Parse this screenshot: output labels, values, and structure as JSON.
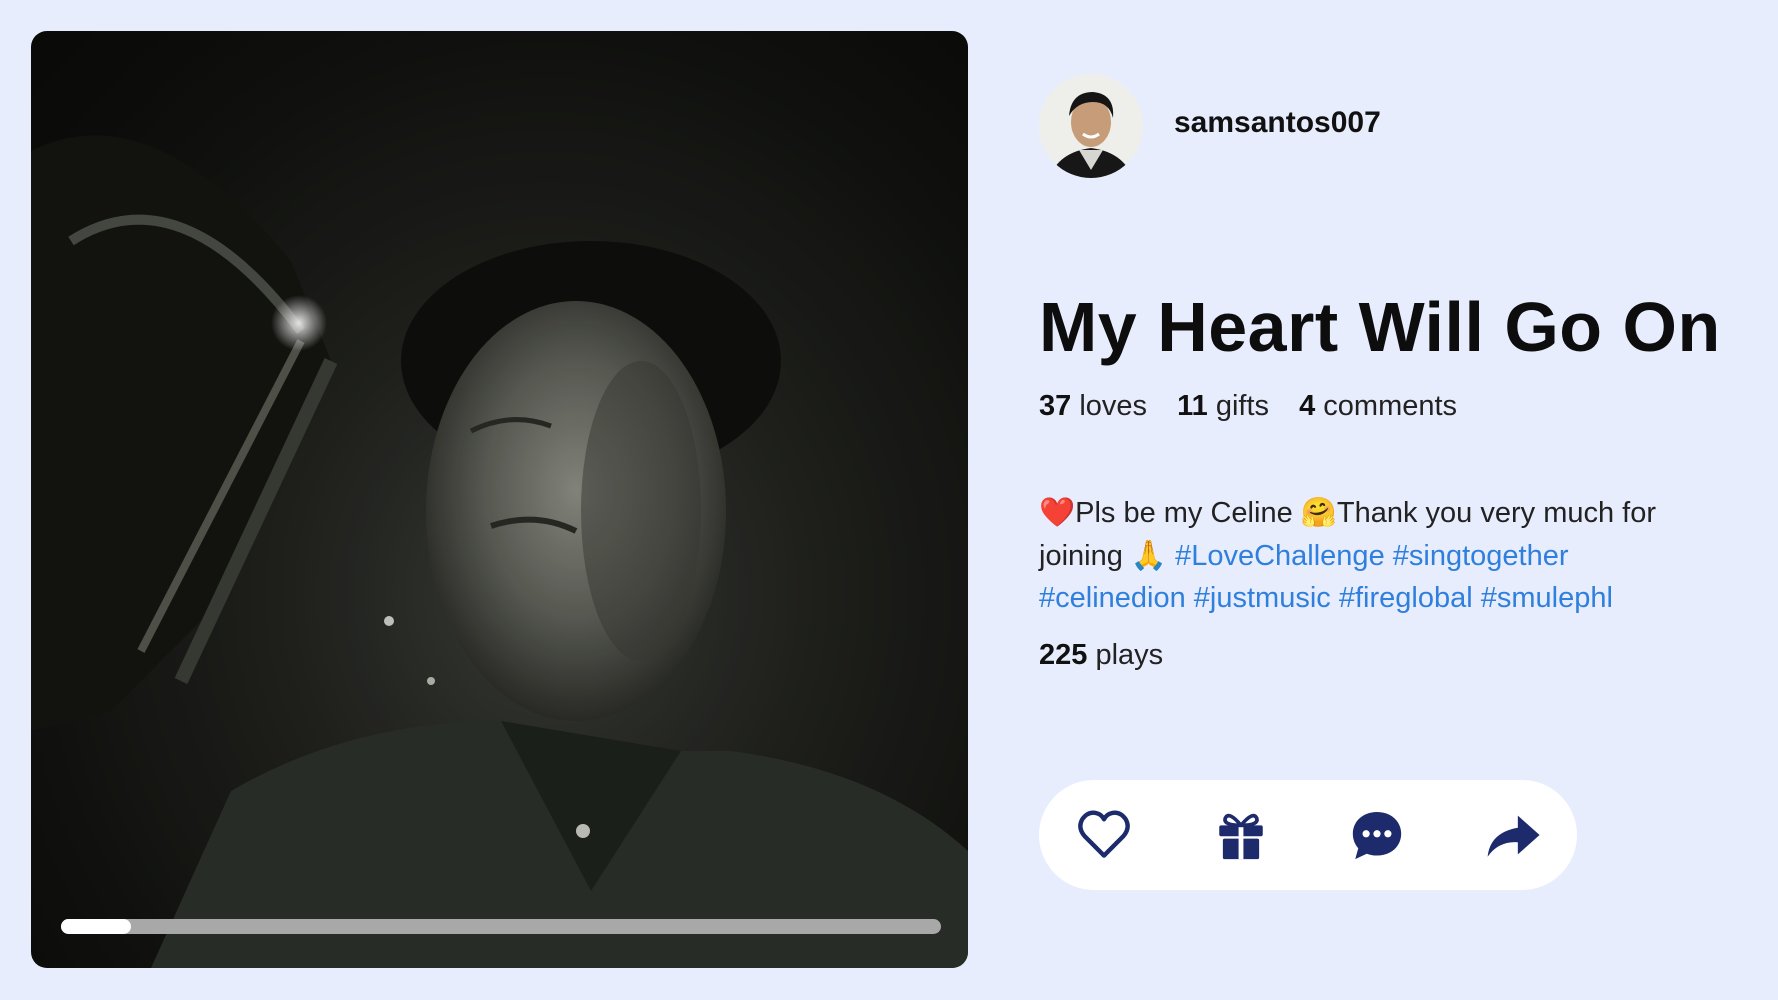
{
  "video": {
    "progress_fraction": 0.08
  },
  "author": {
    "username": "samsantos007"
  },
  "song": {
    "title": "My Heart Will Go On"
  },
  "stats": {
    "loves_count": "37",
    "loves_label": "loves",
    "gifts_count": "11",
    "gifts_label": "gifts",
    "comments_count": "4",
    "comments_label": "comments"
  },
  "description": {
    "heart_emoji": "❤️",
    "text_1": "Pls be my Celine ",
    "hug_emoji": "🤗",
    "text_2": "Thank you very much for joining ",
    "pray_emoji": "🙏",
    "hashtags": [
      "#LoveChallenge",
      "#singtogether",
      "#celinedion",
      "#justmusic",
      "#fireglobal",
      "#smulephl"
    ]
  },
  "plays": {
    "count": "225",
    "label": "plays"
  },
  "actions": {
    "icons": [
      "heart-icon",
      "gift-icon",
      "comment-icon",
      "share-icon"
    ],
    "color": "#1d2a6b"
  }
}
